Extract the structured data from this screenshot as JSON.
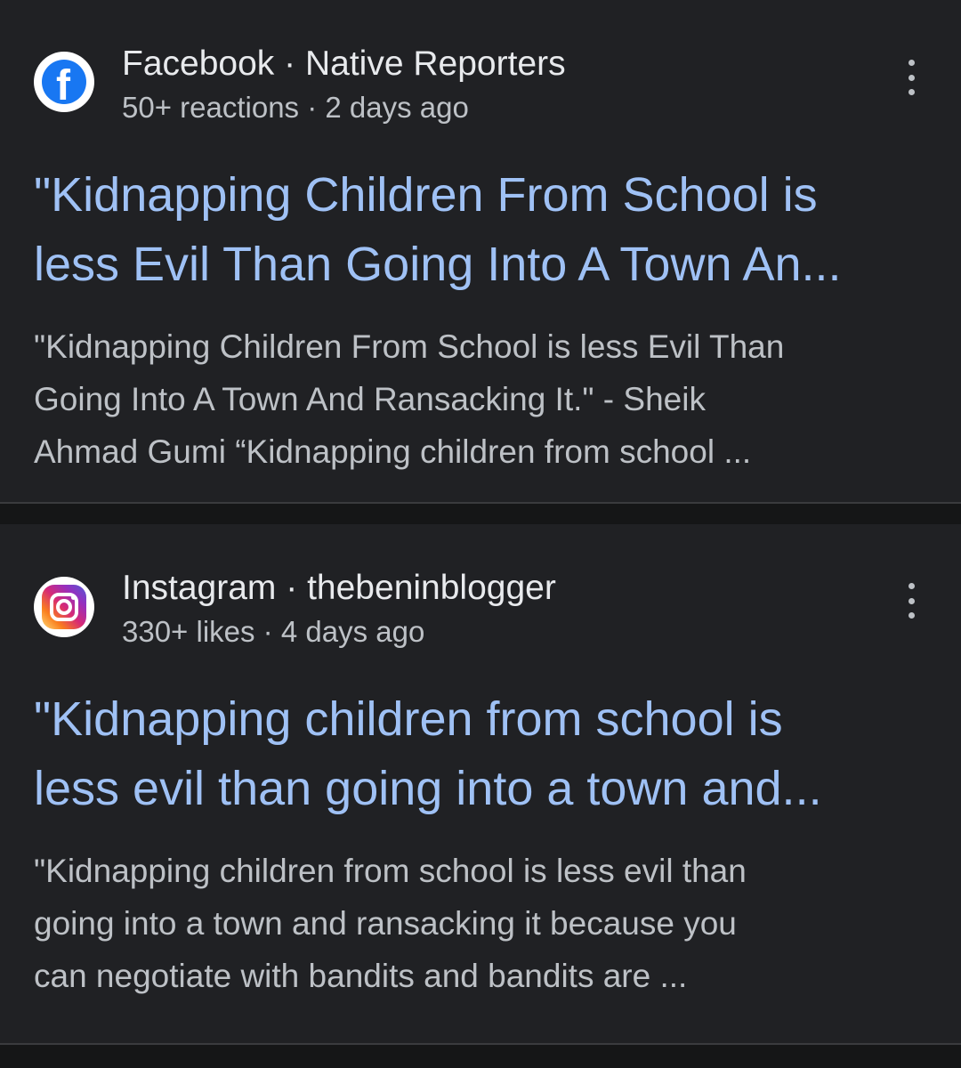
{
  "results": [
    {
      "source": "Facebook",
      "separator": "·",
      "author": "Native Reporters",
      "meta": "50+ reactions · 2 days ago",
      "icon": "facebook-icon",
      "title_lines": [
        "\"Kidnapping Children From School is",
        "less Evil Than Going Into A Town An..."
      ],
      "snippet_lines": [
        "\"Kidnapping Children From School is less Evil Than",
        "Going Into A Town And Ransacking It.\" - Sheik",
        "Ahmad Gumi “Kidnapping children from school ..."
      ]
    },
    {
      "source": "Instagram",
      "separator": "·",
      "author": "thebeninblogger",
      "meta": "330+ likes · 4 days ago",
      "icon": "instagram-icon",
      "title_lines": [
        "\"Kidnapping children from school is",
        "less evil than going into a town and..."
      ],
      "snippet_lines": [
        "\"Kidnapping children from school is less evil than",
        "going into a town and ransacking it because you",
        "can negotiate with bandits and bandits are ..."
      ]
    }
  ],
  "colors": {
    "background": "#202124",
    "title_link": "#9fc1f5",
    "primary_text": "#e8eaed",
    "secondary_text": "#bdc1c6",
    "facebook_blue": "#1877f2"
  }
}
